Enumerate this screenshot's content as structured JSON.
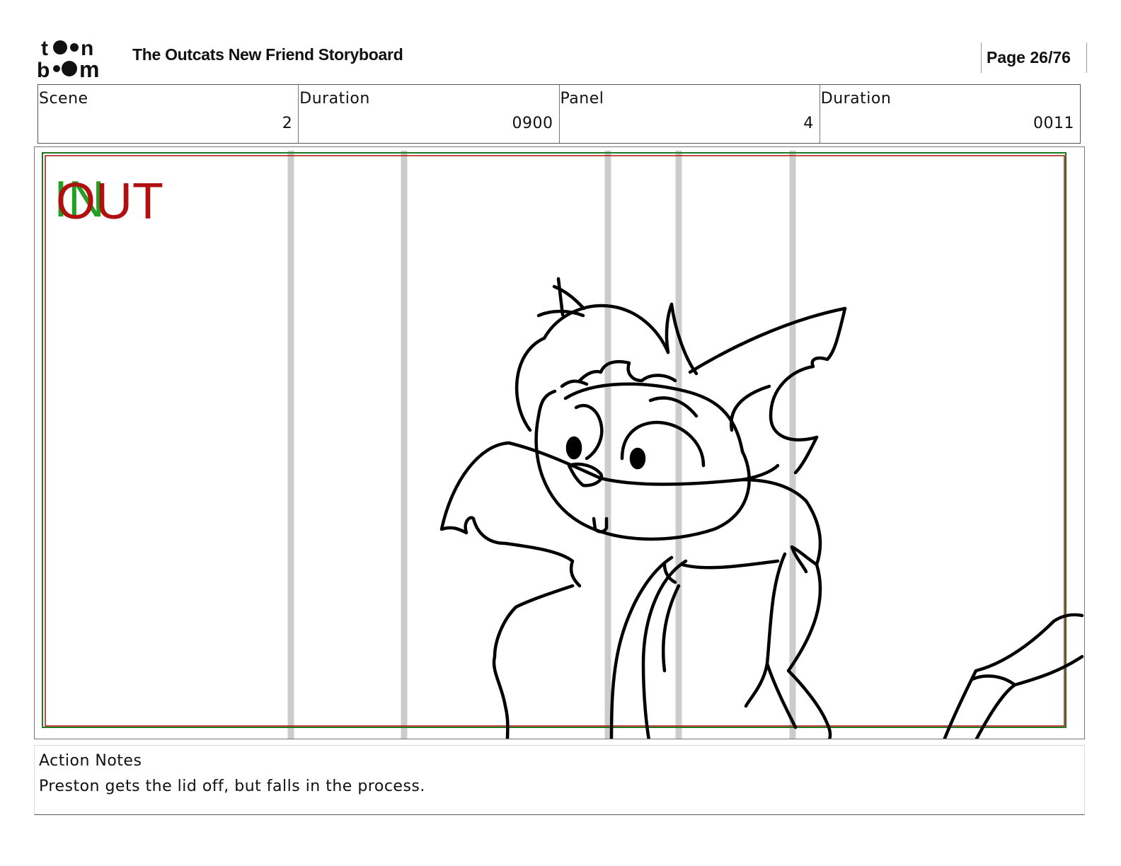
{
  "header": {
    "logo_text": [
      "to",
      "n",
      "b",
      "m"
    ],
    "title": "The Outcats New Friend Storyboard",
    "page": "Page 26/76"
  },
  "info": {
    "scene_label": "Scene",
    "scene_value": "2",
    "scene_duration_label": "Duration",
    "scene_duration_value": "0900",
    "panel_label": "Panel",
    "panel_value": "4",
    "panel_duration_label": "Duration",
    "panel_duration_value": "0011"
  },
  "panel": {
    "in_label": "IN",
    "out_label": "OUT",
    "in_color": "#22a022",
    "out_color": "#b01010",
    "guide_color": "#cccccc",
    "drawing": "cat-character-sketch"
  },
  "notes": {
    "label": "Action Notes",
    "text": "Preston gets the lid off, but falls in the process."
  }
}
